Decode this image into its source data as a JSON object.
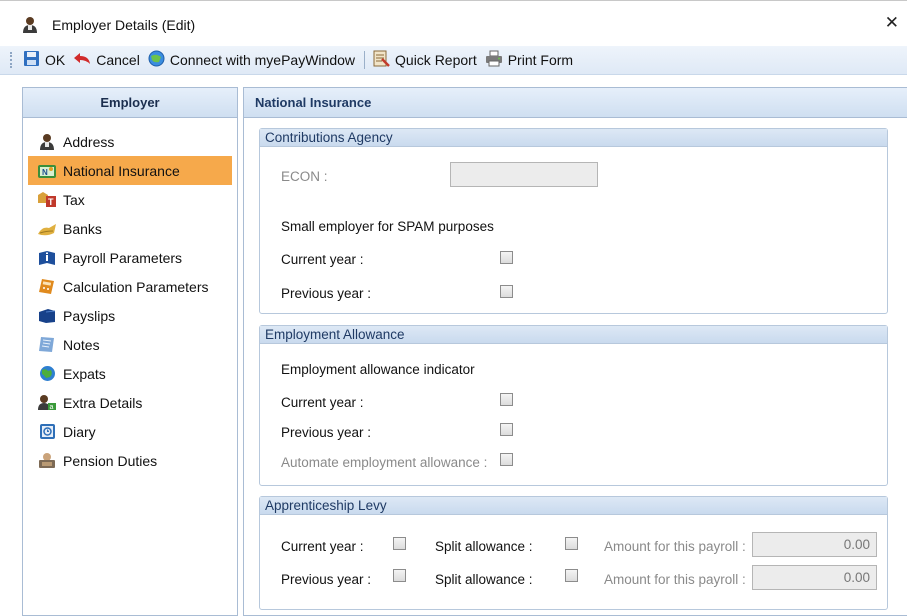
{
  "window": {
    "title": "Employer Details (Edit)",
    "close_glyph": "✕",
    "icon": "employer-person-icon"
  },
  "toolbar": {
    "ok_label": "OK",
    "cancel_label": "Cancel",
    "connect_label": "Connect with myePayWindow",
    "quick_report_label": "Quick Report",
    "print_form_label": "Print Form"
  },
  "left_panel": {
    "header": "Employer",
    "selected_index": 1,
    "items": [
      {
        "label": "Address",
        "icon": "person-icon"
      },
      {
        "label": "National Insurance",
        "icon": "ni-card-icon"
      },
      {
        "label": "Tax",
        "icon": "tax-icon"
      },
      {
        "label": "Banks",
        "icon": "bank-icon"
      },
      {
        "label": "Payroll Parameters",
        "icon": "info-book-icon"
      },
      {
        "label": "Calculation Parameters",
        "icon": "calculator-icon"
      },
      {
        "label": "Payslips",
        "icon": "payslip-book-icon"
      },
      {
        "label": "Notes",
        "icon": "notes-icon"
      },
      {
        "label": "Expats",
        "icon": "globe-icon"
      },
      {
        "label": "Extra Details",
        "icon": "extra-details-icon"
      },
      {
        "label": "Diary",
        "icon": "diary-icon"
      },
      {
        "label": "Pension Duties",
        "icon": "pension-icon"
      }
    ]
  },
  "main": {
    "header": "National Insurance",
    "contributions_agency": {
      "title": "Contributions Agency",
      "econ_label": "ECON :",
      "econ_value": "",
      "small_employer_label": "Small employer for SPAM purposes",
      "current_year_label": "Current year :",
      "previous_year_label": "Previous year :",
      "current_year_checked": false,
      "previous_year_checked": false
    },
    "employment_allowance": {
      "title": "Employment Allowance",
      "indicator_label": "Employment allowance indicator",
      "current_year_label": "Current year :",
      "previous_year_label": "Previous year :",
      "automate_label": "Automate employment allowance :"
    },
    "apprenticeship_levy": {
      "title": "Apprenticeship Levy",
      "current_year_label": "Current year :",
      "previous_year_label": "Previous year :",
      "split_allowance_label": "Split allowance :",
      "amount_label": "Amount for this payroll :",
      "current_amount": "0.00",
      "previous_amount": "0.00"
    }
  },
  "colors": {
    "selected_nav": "#f6a94b",
    "header_text": "#1f3a64",
    "panel_border": "#a9bcd4"
  }
}
